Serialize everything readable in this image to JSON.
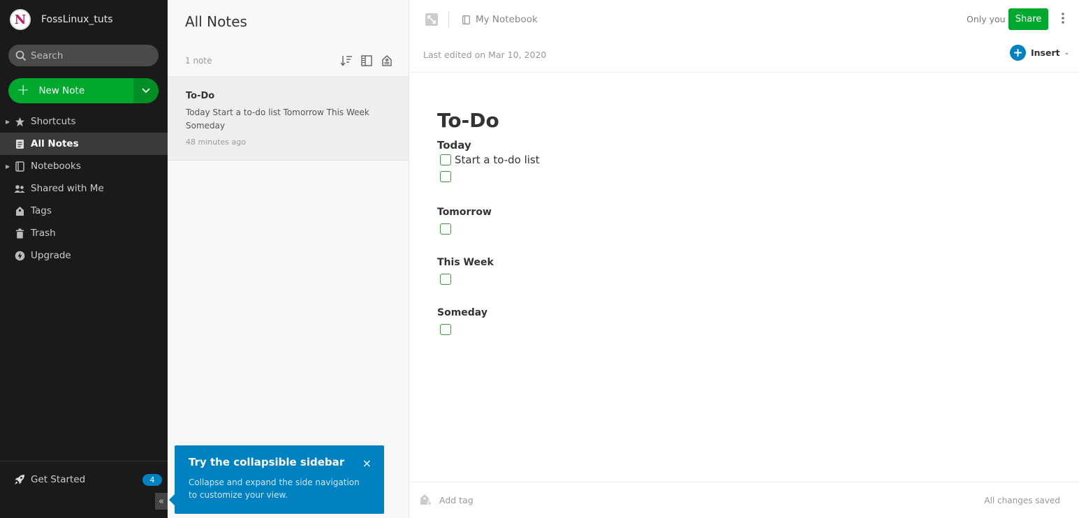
{
  "sidebar": {
    "username": "FossLinux_tuts",
    "avatar_letter": "N",
    "search_placeholder": "Search",
    "new_note_label": "New Note",
    "items": [
      {
        "label": "Shortcuts",
        "icon": "star-icon",
        "expandable": true
      },
      {
        "label": "All Notes",
        "icon": "note-icon",
        "active": true
      },
      {
        "label": "Notebooks",
        "icon": "notebook-icon",
        "expandable": true
      },
      {
        "label": "Shared with Me",
        "icon": "people-icon"
      },
      {
        "label": "Tags",
        "icon": "tag-icon"
      },
      {
        "label": "Trash",
        "icon": "trash-icon"
      },
      {
        "label": "Upgrade",
        "icon": "upgrade-icon"
      }
    ],
    "get_started_label": "Get Started",
    "get_started_badge": "4",
    "collapse_glyph": "«"
  },
  "notelist": {
    "title": "All Notes",
    "count": "1 note",
    "note": {
      "title": "To-Do",
      "snippet": "Today Start a to-do list Tomorrow This Week Someday",
      "time": "48 minutes ago"
    }
  },
  "tooltip": {
    "title": "Try the collapsible sidebar",
    "body": "Collapse and expand the side navigation to customize your view.",
    "close": "×"
  },
  "editor": {
    "notebook": "My Notebook",
    "visibility": "Only you",
    "share_label": "Share",
    "last_edited": "Last edited on Mar 10, 2020",
    "insert_label": "Insert",
    "title": "To-Do",
    "sections": {
      "today": "Today",
      "today_item": "Start a to-do list",
      "tomorrow": "Tomorrow",
      "this_week": "This Week",
      "someday": "Someday"
    },
    "add_tag": "Add tag",
    "saved_status": "All changes saved"
  },
  "colors": {
    "brand_green": "#00a82d",
    "accent_blue": "#0081c2",
    "sidebar_bg": "#1a1a1a"
  }
}
